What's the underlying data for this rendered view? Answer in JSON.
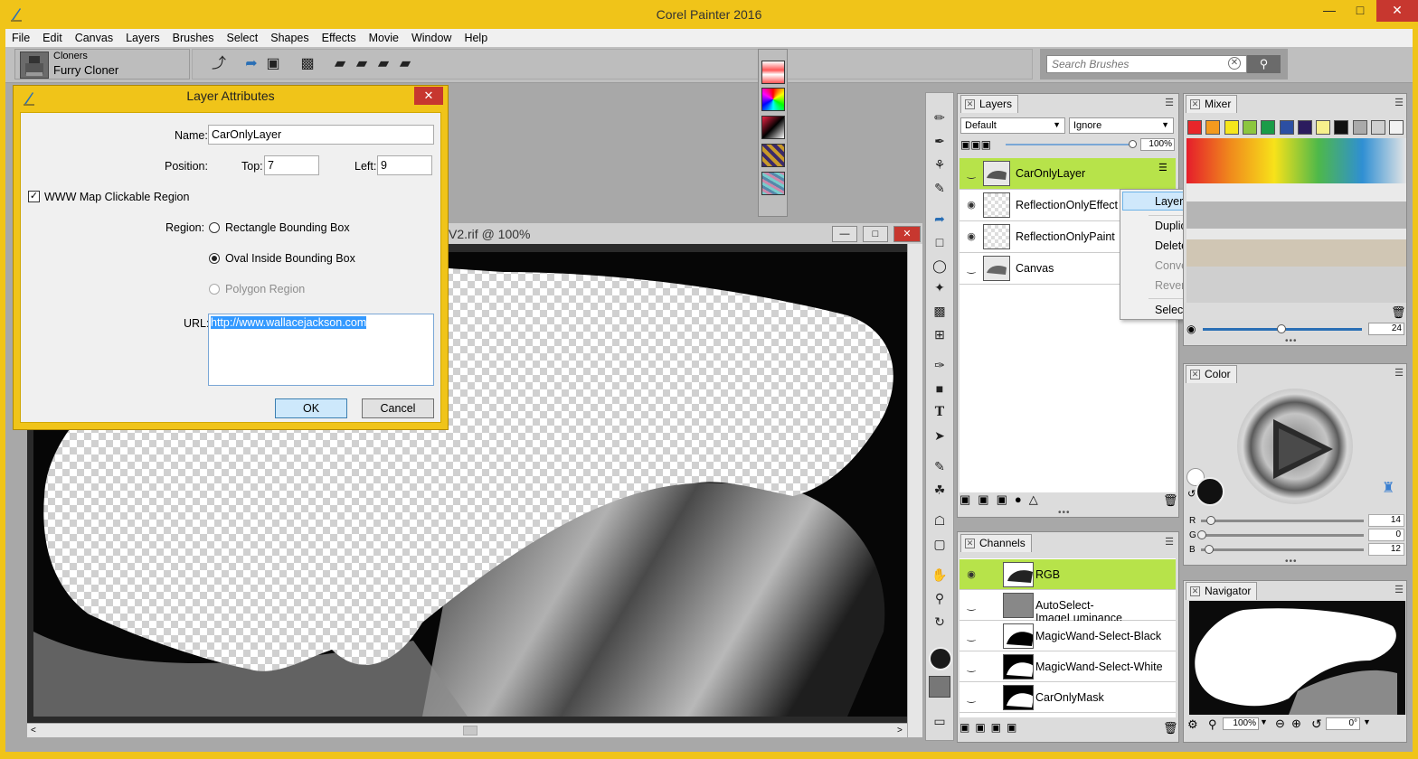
{
  "app": {
    "title": "Corel Painter 2016"
  },
  "menu": [
    "File",
    "Edit",
    "Canvas",
    "Layers",
    "Brushes",
    "Select",
    "Shapes",
    "Effects",
    "Movie",
    "Window",
    "Help"
  ],
  "brush": {
    "category": "Cloners",
    "variant": "Furry Cloner"
  },
  "search": {
    "placeholder": "Search Brushes"
  },
  "document": {
    "title": "V2.rif @ 100%"
  },
  "dialog": {
    "title": "Layer Attributes",
    "name_label": "Name:",
    "name_value": "CarOnlyLayer",
    "position_label": "Position:",
    "top_label": "Top:",
    "top_value": "7",
    "left_label": "Left:",
    "left_value": "9",
    "www_label": "WWW Map Clickable Region",
    "www_checked": true,
    "region_label": "Region:",
    "region_options": [
      "Rectangle Bounding Box",
      "Oval Inside Bounding Box",
      "Polygon Region"
    ],
    "region_selected": "Oval Inside Bounding Box",
    "url_label": "URL:",
    "url_value": "http://www.wallacejackson.com",
    "ok_label": "OK",
    "cancel_label": "Cancel"
  },
  "layers_panel": {
    "title": "Layers",
    "composite_method": "Default",
    "preserve": "Ignore",
    "opacity": "100%",
    "layers": [
      {
        "name": "CarOnlyLayer",
        "selected": true
      },
      {
        "name": "ReflectionOnlyEffect",
        "selected": false
      },
      {
        "name": "ReflectionOnlyPaint",
        "selected": false
      },
      {
        "name": "Canvas",
        "selected": false
      }
    ]
  },
  "context_menu": {
    "items": [
      {
        "label": "Layer Attributes...",
        "enabled": true,
        "highlighted": true
      },
      {
        "label": "Duplicate Layer",
        "enabled": true
      },
      {
        "label": "Delete Layer",
        "enabled": true
      },
      {
        "label": "Convert To Default Layer",
        "enabled": false
      },
      {
        "label": "Revert to Original",
        "enabled": false
      },
      {
        "label": "Select Layer Content",
        "enabled": true
      }
    ]
  },
  "channels_panel": {
    "title": "Channels",
    "channels": [
      {
        "name": "RGB",
        "selected": true
      },
      {
        "name": "AutoSelect-ImageLuminance",
        "selected": false
      },
      {
        "name": "MagicWand-Select-Black",
        "selected": false
      },
      {
        "name": "MagicWand-Select-White",
        "selected": false
      },
      {
        "name": "CarOnlyMask",
        "selected": false
      }
    ]
  },
  "mixer_panel": {
    "title": "Mixer",
    "brush_size": "24",
    "swatches": [
      "#e8262a",
      "#f39a1e",
      "#f6e61c",
      "#8cc63f",
      "#1a9c48",
      "#2c4fa3",
      "#2b1c5e",
      "#f7f08c",
      "#111111",
      "#aaaaaa",
      "#cfcfcf",
      "#f2f2f2"
    ]
  },
  "color_panel": {
    "title": "Color",
    "r_label": "R",
    "r_value": "14",
    "g_label": "G",
    "g_value": "0",
    "b_label": "B",
    "b_value": "12"
  },
  "navigator_panel": {
    "title": "Navigator",
    "zoom": "100%",
    "rotation": "0°"
  }
}
